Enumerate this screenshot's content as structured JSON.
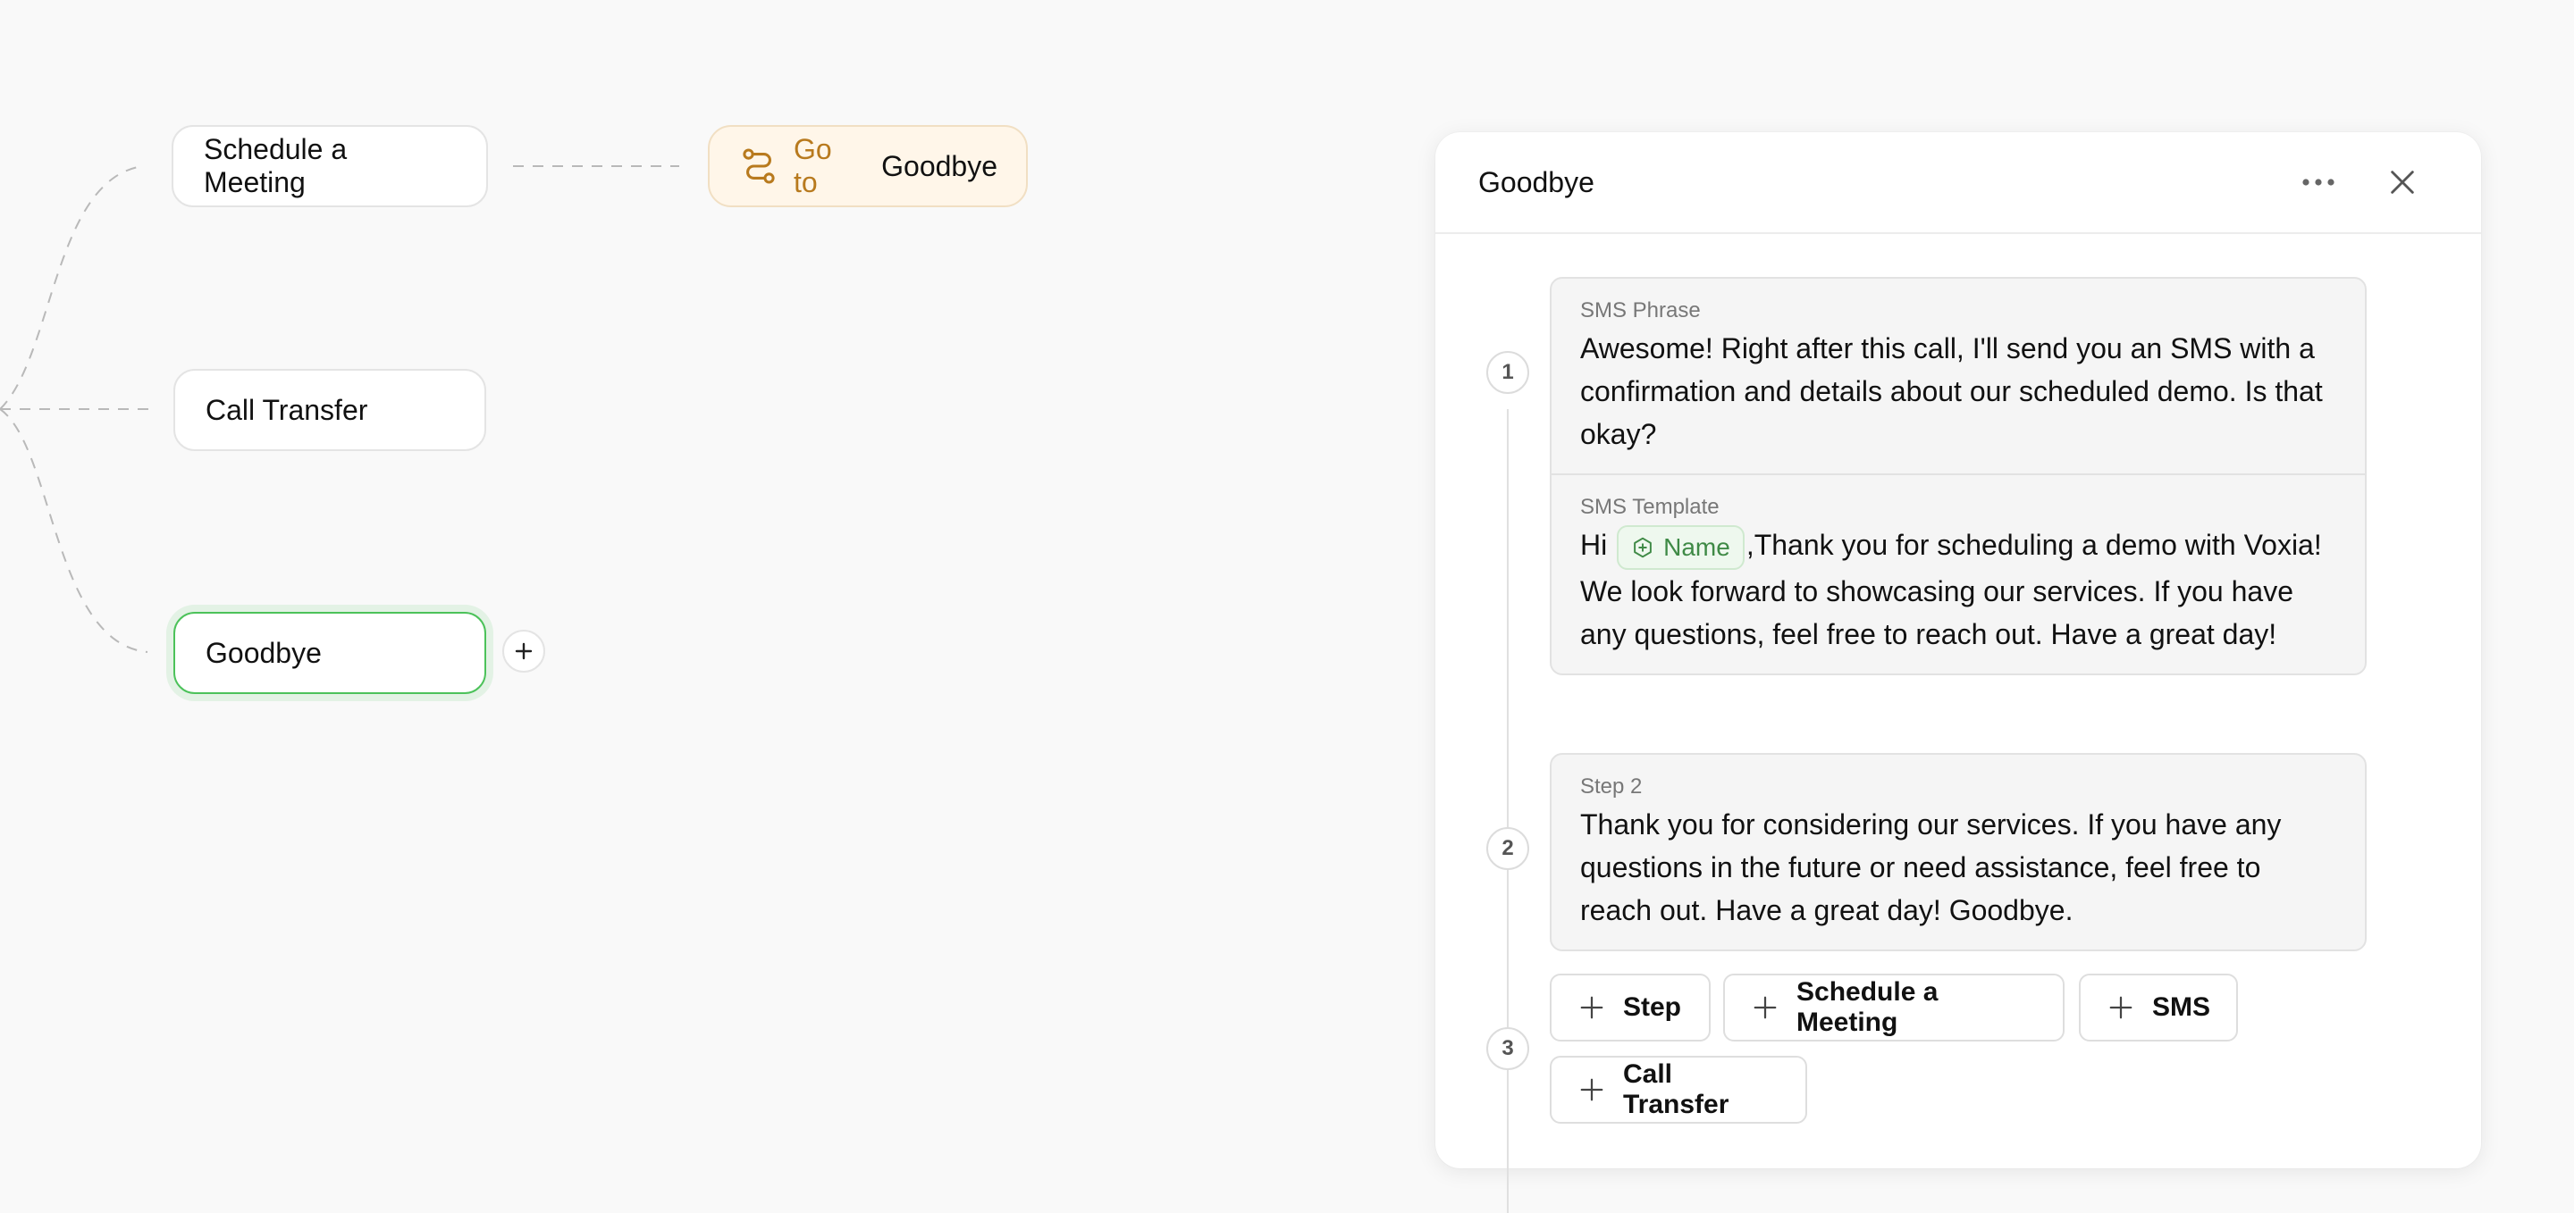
{
  "canvas": {
    "nodes": {
      "schedule_meeting": "Schedule a Meeting",
      "call_transfer": "Call Transfer",
      "goodbye": "Goodbye"
    },
    "goto": {
      "label": "Go to",
      "target": "Goodbye",
      "icon": "route-icon"
    },
    "add_icon": "plus-icon",
    "colors": {
      "selected_border": "#4cc25a",
      "goto_bg": "#fff6e9",
      "goto_text": "#b87a1e"
    }
  },
  "panel": {
    "title": "Goodbye",
    "more_icon": "more-horizontal-icon",
    "close_icon": "close-icon",
    "steps": [
      {
        "number": "1",
        "sections": [
          {
            "label": "SMS Phrase",
            "text": "Awesome! Right after this call, I'll send you an SMS with a confirmation and details about our scheduled demo. Is that okay?"
          },
          {
            "label": "SMS Template",
            "prefix": "Hi",
            "variable": "Name",
            "variable_icon": "variable-hexagon-icon",
            "suffix": ",Thank you for scheduling a demo with Voxia! We look forward to showcasing our services. If you have any questions, feel free to reach out. Have a great day!"
          }
        ]
      },
      {
        "number": "2",
        "label": "Step 2",
        "text": "Thank you for considering our services. If you have any questions in the future or need assistance, feel free to reach out. Have a great day! Goodbye."
      },
      {
        "number": "3",
        "actions": [
          "Step",
          "Schedule a Meeting",
          "SMS",
          "Call Transfer"
        ]
      }
    ]
  }
}
